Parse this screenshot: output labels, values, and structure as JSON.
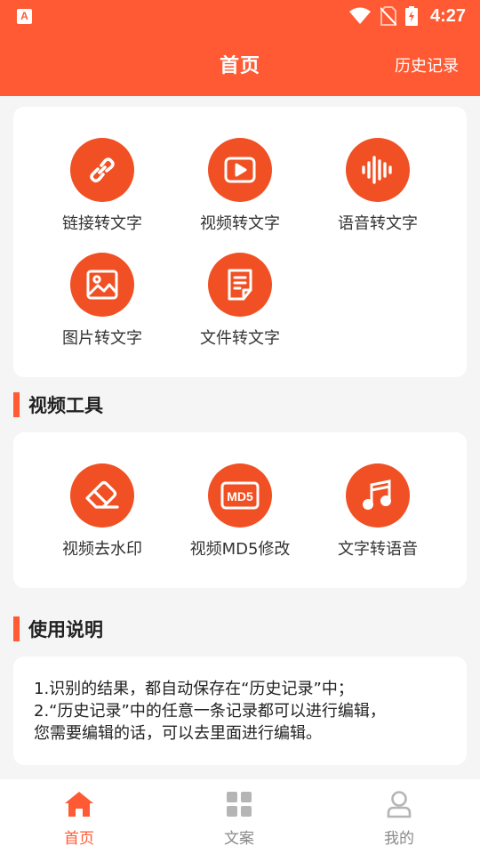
{
  "status_bar": {
    "app_badge": "A",
    "time": "4:27"
  },
  "header": {
    "title": "首页",
    "history_link": "历史记录"
  },
  "tools": [
    {
      "label": "链接转文字",
      "icon": "link-icon"
    },
    {
      "label": "视频转文字",
      "icon": "video-play-icon"
    },
    {
      "label": "语音转文字",
      "icon": "soundwave-icon"
    },
    {
      "label": "图片转文字",
      "icon": "image-icon"
    },
    {
      "label": "文件转文字",
      "icon": "document-icon"
    }
  ],
  "video_tools": {
    "title": "视频工具",
    "items": [
      {
        "label": "视频去水印",
        "icon": "eraser-icon"
      },
      {
        "label": "视频MD5修改",
        "icon": "md5-icon"
      },
      {
        "label": "文字转语音",
        "icon": "music-note-icon"
      }
    ]
  },
  "usage": {
    "title": "使用说明",
    "lines": [
      "1.识别的结果，都自动保存在“历史记录”中；",
      "2.“历史记录”中的任意一条记录都可以进行编辑，",
      "您需要编辑的话，可以去里面进行编辑。"
    ]
  },
  "tabbar": {
    "tabs": [
      {
        "label": "首页",
        "icon": "home-icon",
        "active": true
      },
      {
        "label": "文案",
        "icon": "grid-icon",
        "active": false
      },
      {
        "label": "我的",
        "icon": "user-icon",
        "active": false
      }
    ],
    "active_color": "#ff5a33",
    "inactive_color": "#8a8a8a"
  },
  "colors": {
    "accent": "#ff5a33",
    "icon_circle": "#f05023"
  }
}
